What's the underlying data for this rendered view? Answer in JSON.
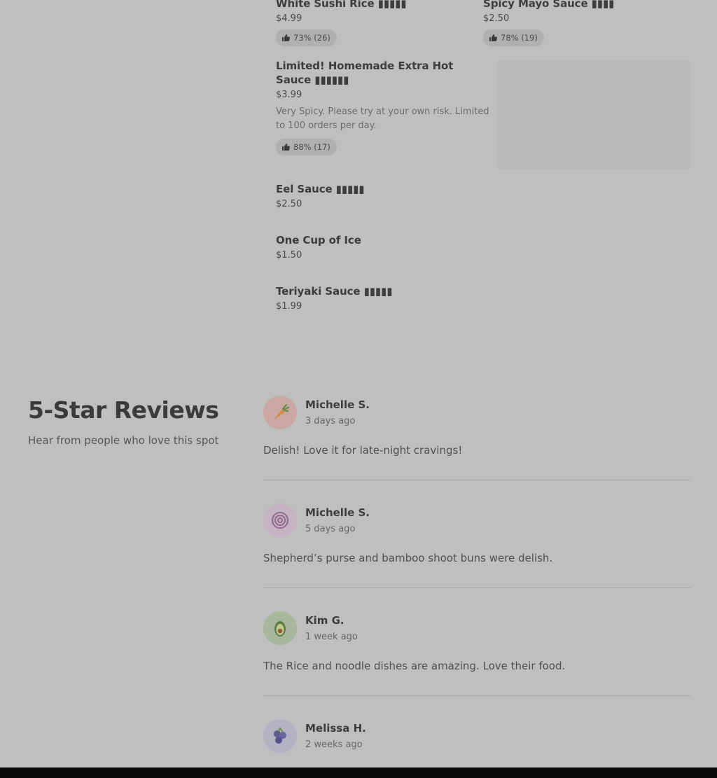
{
  "menu": {
    "top_items": [
      {
        "name": "White Sushi Rice ▮▮▮▮▮",
        "price": "$4.99",
        "rating": "73% (26)"
      },
      {
        "name": "Spicy Mayo Sauce ▮▮▮▮",
        "price": "$2.50",
        "rating": "78% (19)"
      }
    ],
    "featured": {
      "name": "Limited! Homemade Extra Hot Sauce ▮▮▮▮▮▮",
      "price": "$3.99",
      "description": "Very Spicy. Please try at your own risk. Limited to 100 orders per day.",
      "rating": "88% (17)"
    },
    "items": [
      {
        "name": "Eel Sauce ▮▮▮▮▮",
        "price": "$2.50"
      },
      {
        "name": "One Cup of Ice",
        "price": "$1.50"
      },
      {
        "name": "Teriyaki Sauce ▮▮▮▮▮",
        "price": "$1.99"
      }
    ]
  },
  "reviews_section": {
    "title": "5-Star Reviews",
    "subtitle": "Hear from people who love this spot",
    "reviews": [
      {
        "name": "Michelle S.",
        "date": "3 days ago",
        "text": "Delish! Love it for late-night cravings!",
        "avatar": "carrot-icon",
        "avatar_color": "#c9a8a4"
      },
      {
        "name": "Michelle S.",
        "date": "5 days ago",
        "text": "Shepherd’s purse and bamboo shoot buns were delish.",
        "avatar": "onion-icon",
        "avatar_color": "#c5b3c3"
      },
      {
        "name": "Kim G.",
        "date": "1 week ago",
        "text": "The Rice and noodle dishes are amazing. Love their food.",
        "avatar": "avocado-icon",
        "avatar_color": "#a7b89c"
      },
      {
        "name": "Melissa H.",
        "date": "2 weeks ago",
        "text": "",
        "avatar": "blueberry-icon",
        "avatar_color": "#b3b2c2"
      }
    ]
  }
}
